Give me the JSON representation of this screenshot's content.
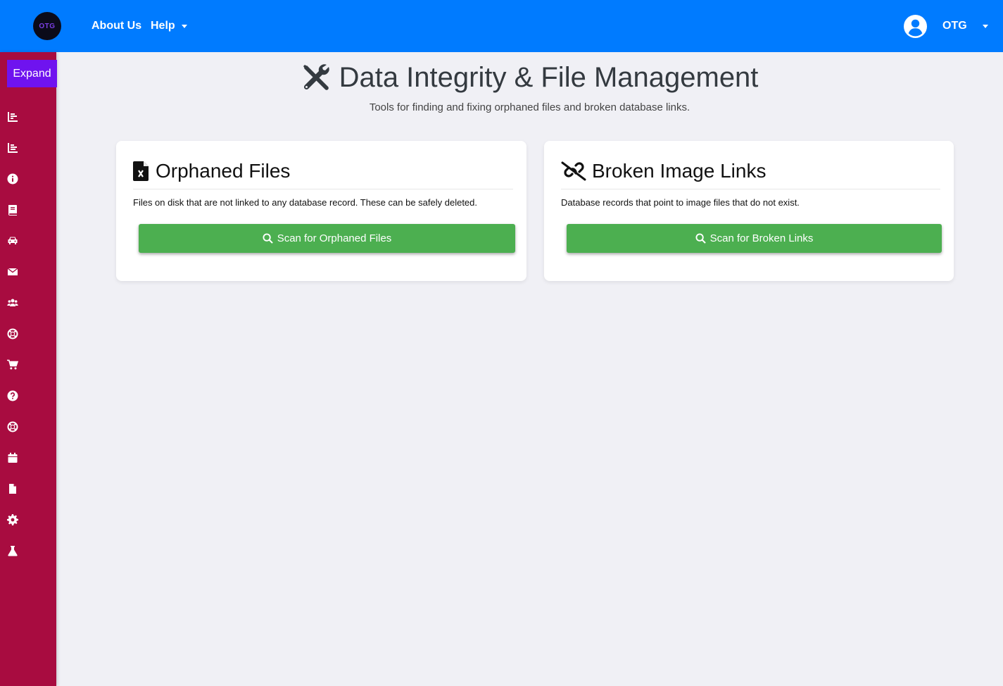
{
  "navbar": {
    "logo_text": "OTG",
    "about": "About Us",
    "help": "Help",
    "user_name": "OTG"
  },
  "sidebar": {
    "expand_label": "Expand",
    "icons": [
      "chart-line-icon",
      "chart-bar-icon",
      "info-circle-icon",
      "book-icon",
      "car-icon",
      "envelope-icon",
      "users-icon",
      "life-ring-icon",
      "shopping-cart-icon",
      "question-circle-icon",
      "life-ring-icon",
      "calendar-icon",
      "file-icon",
      "gear-icon",
      "flask-icon"
    ]
  },
  "page": {
    "title": "Data Integrity & File Management",
    "subtitle": "Tools for finding and fixing orphaned files and broken database links."
  },
  "cards": {
    "orphaned": {
      "title": "Orphaned Files",
      "description": "Files on disk that are not linked to any database record. These can be safely deleted.",
      "button": "Scan for Orphaned Files"
    },
    "broken": {
      "title": "Broken Image Links",
      "description": "Database records that point to image files that do not exist.",
      "button": "Scan for Broken Links"
    }
  },
  "colors": {
    "navbar": "#007bff",
    "sidebar": "#a80c40",
    "expand": "#6f13ef",
    "button": "#4caf50"
  }
}
